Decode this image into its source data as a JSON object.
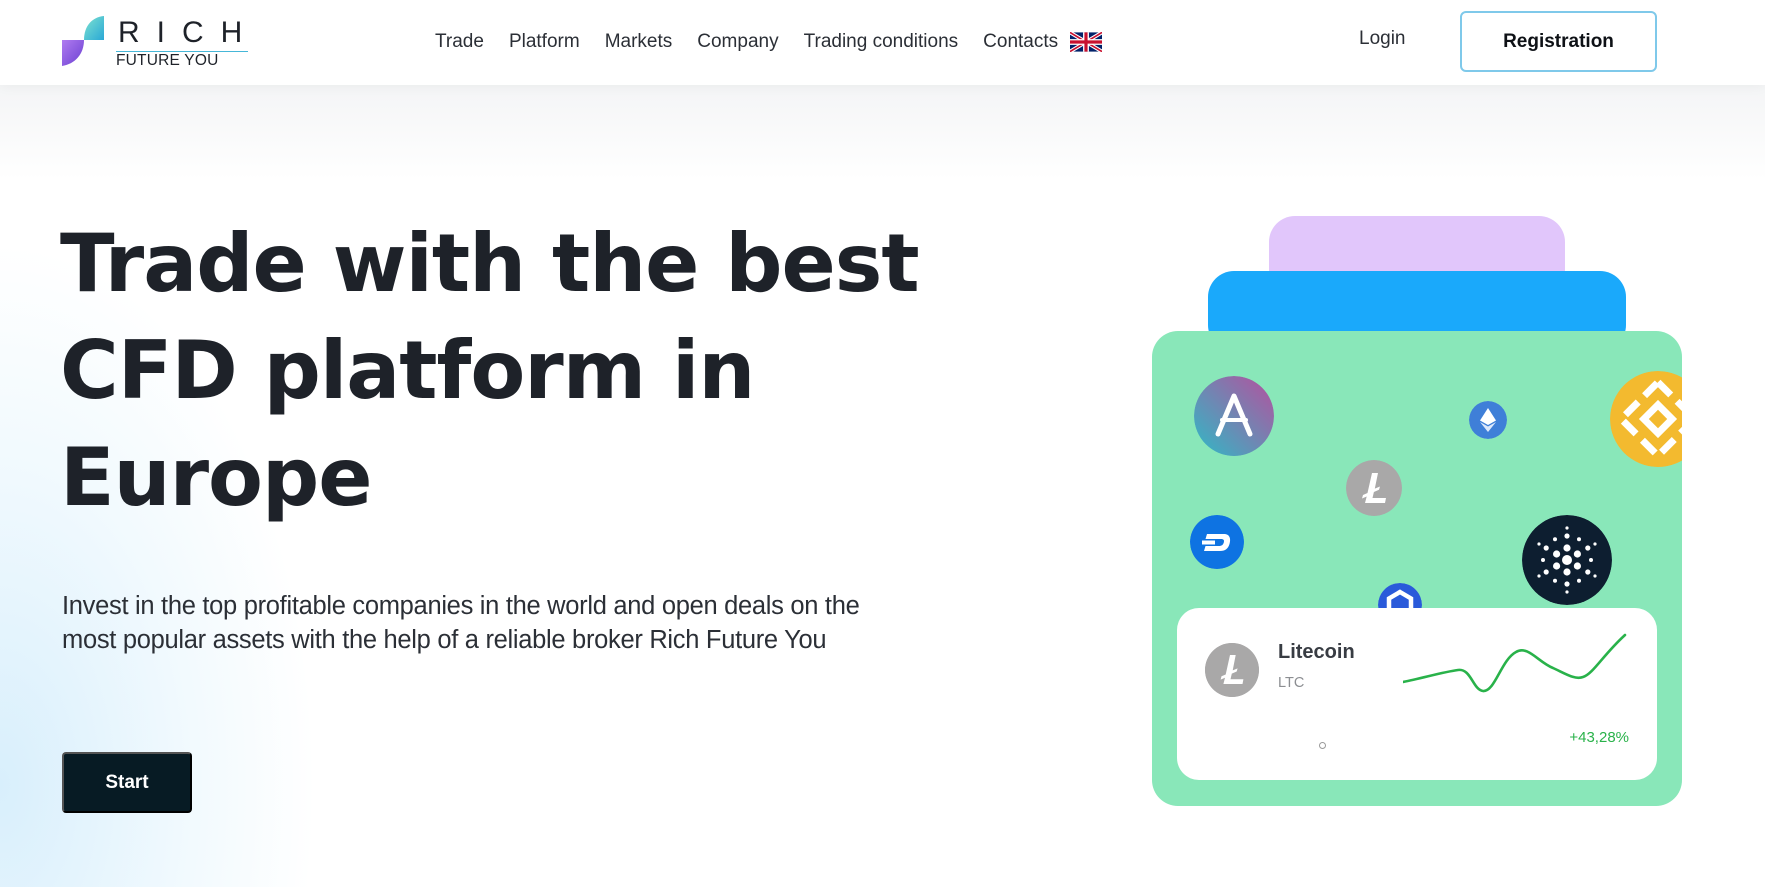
{
  "header": {
    "logo": {
      "word": "RICH",
      "tagline": "FUTURE YOU"
    },
    "nav": [
      {
        "label": "Trade"
      },
      {
        "label": "Platform"
      },
      {
        "label": "Markets"
      },
      {
        "label": "Company"
      },
      {
        "label": "Trading conditions"
      },
      {
        "label": "Contacts"
      }
    ],
    "language_icon": "uk-flag-icon",
    "login_label": "Login",
    "registration_label": "Registration"
  },
  "hero": {
    "headline": "Trade with the best CFD platform in Europe",
    "subtext": "Invest in the top profitable companies in the world and open deals on the most popular assets with the help of a reliable broker Rich Future You",
    "start_label": "Start"
  },
  "illustration": {
    "coins": [
      "aave-icon",
      "ethereum-icon",
      "binance-icon",
      "litecoin-icon",
      "dash-icon",
      "cardano-icon",
      "chainlink-icon"
    ],
    "ticker_card": {
      "name": "Litecoin",
      "symbol": "LTC",
      "change": "+43,28%",
      "change_color": "#29b24a"
    }
  },
  "colors": {
    "accent_border": "#7fc9ea",
    "start_button": "#071b24",
    "card_green": "#89e7b9",
    "card_blue": "#1aa9fb",
    "card_purple": "#e1c6fb"
  }
}
